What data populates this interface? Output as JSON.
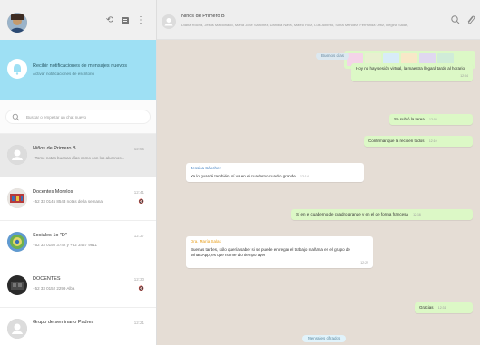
{
  "left": {
    "notification": {
      "title": "Recibir notificaciones de mensajes nuevos",
      "subtitle": "Activar notificaciones de escritorio"
    },
    "search": {
      "placeholder": "Buscar o empezar un chat nuevo"
    },
    "chats": [
      {
        "name": "Niños de Primero B",
        "time": "12:55",
        "preview": "~Tomé notas buenas días como con los alumnos...",
        "muted": false,
        "avatar": "group-default"
      },
      {
        "name": "Docentes Morelos",
        "time": "12:41",
        "preview": "+52 33 0145 8543 notas de la semana",
        "muted": true,
        "avatar": "photo-building"
      },
      {
        "name": "Sociales 1o \"D\"",
        "time": "12:37",
        "preview": "+52 33 0150 3742 y +52 3457 9811",
        "muted": false,
        "avatar": "photo-landscape"
      },
      {
        "name": "DOCENTES",
        "time": "12:30",
        "preview": "+52 33 0152 2299 Alba",
        "muted": true,
        "avatar": "photo-dark"
      },
      {
        "name": "Grupo de seminario Padres",
        "time": "12:21",
        "preview": "",
        "muted": false,
        "avatar": "group-default"
      }
    ]
  },
  "right": {
    "header": {
      "title": "Niños de Primero B",
      "members": "Diana Rocha, Jesús Maldonado, María José Sánchez, Daniela Nava, Mateo Ruiz, Luis Alberto, Sofía Méndez, Fernanda Ortiz, Regina Salas, Tú"
    },
    "messages": [
      {
        "kind": "out",
        "text": "Buenos días",
        "time": "12:01"
      },
      {
        "kind": "out",
        "text": "Hoy no hay sesión virtual, la maestra llegará tarde al horario",
        "time": "12:04"
      },
      {
        "kind": "out",
        "text": "Se subió la tarea",
        "time": "12:06"
      },
      {
        "kind": "out",
        "text": "Confirmar que la reciben todos",
        "time": "12:10"
      },
      {
        "kind": "in",
        "sender": "Jessica Sánchez",
        "text": "Ya lo guardé también, sí va en el cuaderno cuadro grande",
        "time": "12:14"
      },
      {
        "kind": "out",
        "text": "Sí en el cuaderno de cuadro grande y en el de forma francesa",
        "time": "12:16"
      },
      {
        "kind": "in",
        "sender": "Dra. María Salas",
        "text": "Buenas tardes, sólo quería saber si se puede entregar el trabajo mañana en el grupo de WhatsApp, es que no me dio tiempo ayer",
        "time": "12:22"
      },
      {
        "kind": "out",
        "text": "Gracias",
        "time": "12:31"
      },
      {
        "kind": "system",
        "text": "Mensajes cifrados",
        "time": ""
      }
    ]
  },
  "colors": {
    "accent": "#9ee0f4",
    "bubble_out": "#dcf8c6",
    "bubble_in": "#ffffff",
    "chat_bg": "#e5ddd5",
    "sender_blue": "#3a7bbf",
    "sender_orange": "#e8a020"
  },
  "icons": {
    "header_left": [
      "status-icon",
      "new-chat-icon",
      "menu-icon"
    ],
    "header_right": [
      "search-icon",
      "attach-icon"
    ]
  }
}
